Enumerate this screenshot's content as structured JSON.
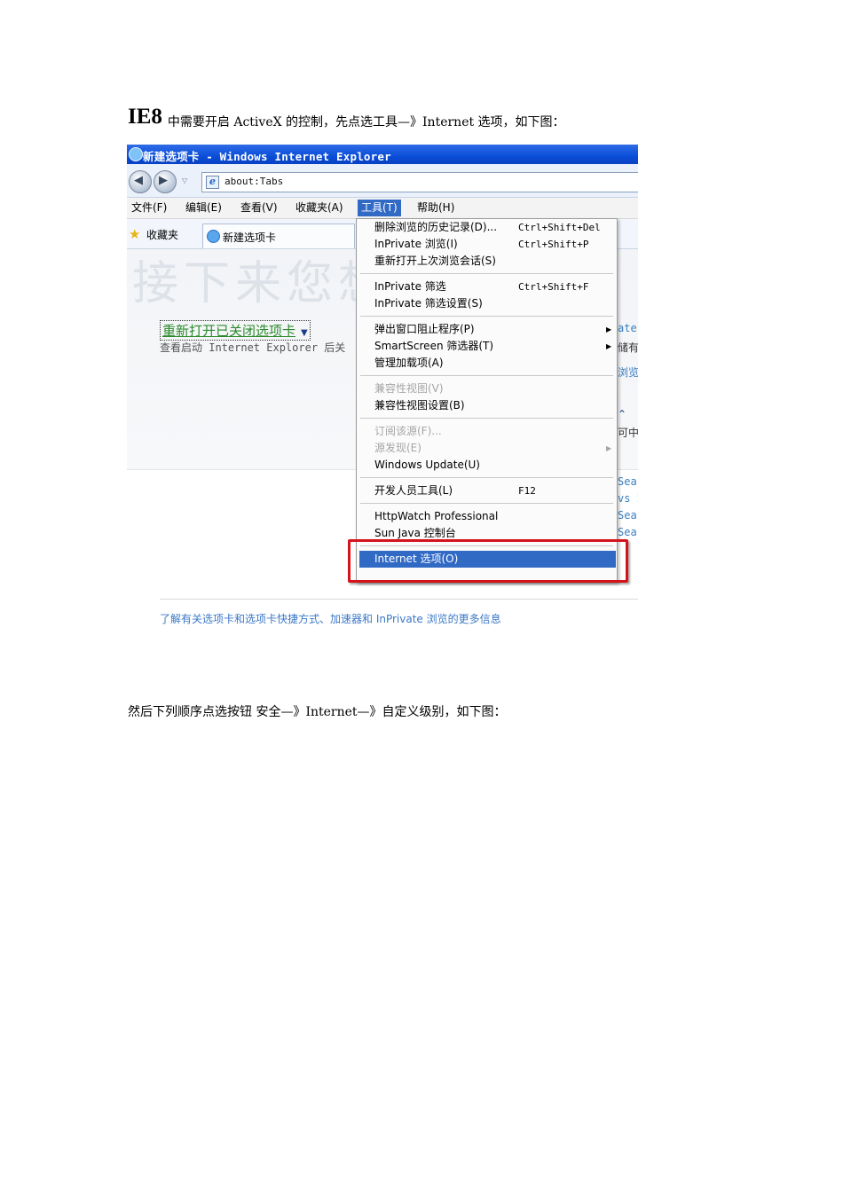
{
  "doc": {
    "heading_big": "IE8",
    "heading_text": "中需要开启 ActiveX 的控制，先点选工具—》Internet 选项，如下图：",
    "paragraph2": "然后下列顺序点选按钮  安全—》Internet—》自定义级别，如下图："
  },
  "browser": {
    "title": "新建选项卡 - Windows Internet Explorer",
    "address": "about:Tabs",
    "menu": [
      "文件(F)",
      "编辑(E)",
      "查看(V)",
      "收藏夹(A)",
      "工具(T)",
      "帮助(H)"
    ],
    "favorites_label": "收藏夹",
    "tab_label": "新建选项卡",
    "ghost_text": "接下来您想",
    "reopen_link": "重新打开已关闭选项卡",
    "view_line": "查看启动 Internet Explorer 后关",
    "right_fragments": [
      "ate",
      "储有",
      "浏览",
      "可中文",
      "Sear",
      "vs I",
      "Sear",
      "Sear"
    ],
    "learn_more": "了解有关选项卡和选项卡快捷方式、加速器和 InPrivate 浏览的更多信息"
  },
  "tools_menu": {
    "items": [
      {
        "label": "删除浏览的历史记录(D)...",
        "shortcut": "Ctrl+Shift+Del"
      },
      {
        "label": "InPrivate 浏览(I)",
        "shortcut": "Ctrl+Shift+P"
      },
      {
        "label": "重新打开上次浏览会话(S)",
        "shortcut": ""
      },
      {
        "label": "InPrivate 筛选",
        "shortcut": "Ctrl+Shift+F"
      },
      {
        "label": "InPrivate 筛选设置(S)",
        "shortcut": ""
      },
      {
        "label": "弹出窗口阻止程序(P)",
        "shortcut": ""
      },
      {
        "label": "SmartScreen 筛选器(T)",
        "shortcut": ""
      },
      {
        "label": "管理加载项(A)",
        "shortcut": ""
      },
      {
        "label": "兼容性视图(V)",
        "shortcut": ""
      },
      {
        "label": "兼容性视图设置(B)",
        "shortcut": ""
      },
      {
        "label": "订阅该源(F)...",
        "shortcut": ""
      },
      {
        "label": "源发现(E)",
        "shortcut": ""
      },
      {
        "label": "Windows Update(U)",
        "shortcut": ""
      },
      {
        "label": "开发人员工具(L)",
        "shortcut": "F12"
      },
      {
        "label": "HttpWatch Professional",
        "shortcut": ""
      },
      {
        "label": "Sun Java 控制台",
        "shortcut": ""
      },
      {
        "label": "Internet 选项(O)",
        "shortcut": ""
      }
    ]
  }
}
